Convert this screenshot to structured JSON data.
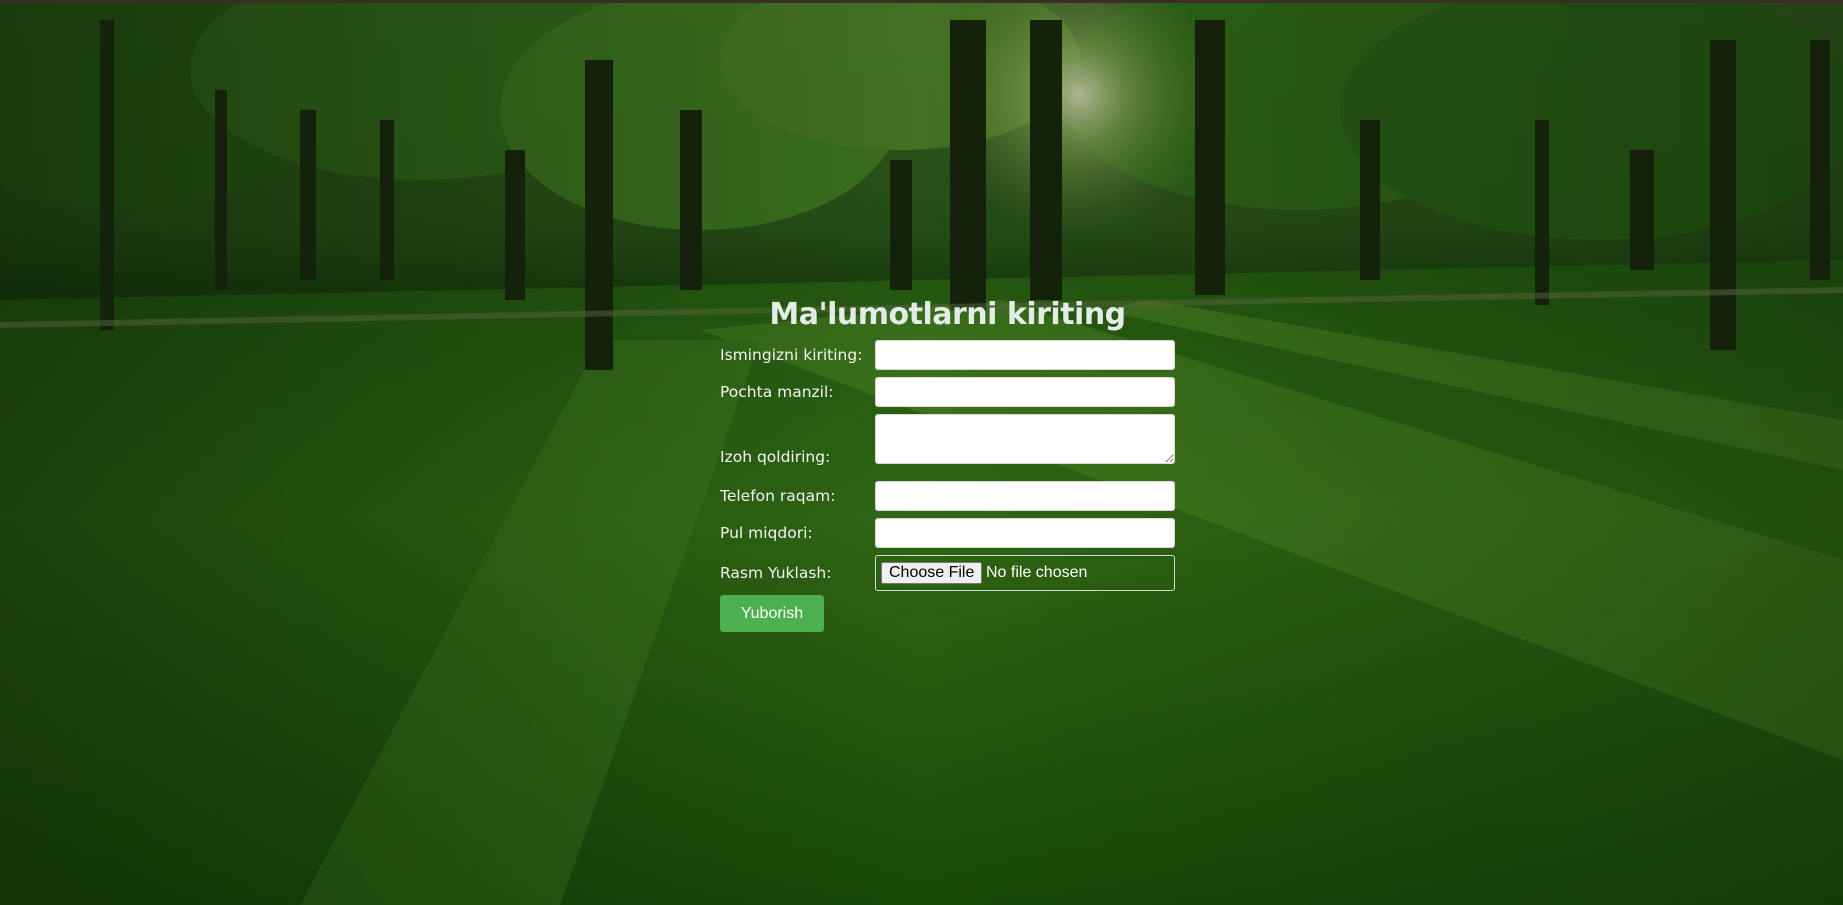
{
  "page": {
    "title": "Ma'lumotlarni kiriting"
  },
  "form": {
    "fields": [
      {
        "label": "Ismingizni kiriting:",
        "value": "",
        "type": "text"
      },
      {
        "label": "Pochta manzil:",
        "value": "",
        "type": "email"
      },
      {
        "label": "Izoh qoldiring:",
        "value": "",
        "type": "textarea"
      },
      {
        "label": "Telefon raqam:",
        "value": "",
        "type": "tel"
      },
      {
        "label": "Pul miqdori:",
        "value": "",
        "type": "number"
      }
    ],
    "file_upload": {
      "label": "Rasm Yuklash:",
      "button_label": "Choose File",
      "status": "No file chosen"
    },
    "submit_label": "Yuborish"
  },
  "colors": {
    "submit_button": "#4caf50",
    "title_text": "#e3ece6",
    "background": "#1c4a10"
  },
  "background": {
    "scene": "park-forest-photo"
  }
}
